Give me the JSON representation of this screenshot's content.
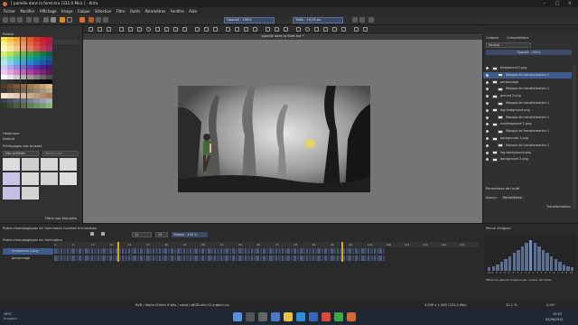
{
  "window": {
    "title": "[ pareille dans la foret.kra (332,0 Mio) ] - Krita"
  },
  "menu": [
    "Fichier",
    "Modifier",
    "Affichage",
    "Image",
    "Calque",
    "Sélection",
    "Filtre",
    "Outils",
    "Paramètres",
    "Fenêtre",
    "Aide"
  ],
  "toolbar": {
    "opacity_label": "Opacité : 100%",
    "size_label": "Taille : 10,00 px"
  },
  "left_panel": {
    "palette_title": "Palette",
    "history_title": "Historique",
    "brushes_title": "Préréglages des brosses",
    "tag_value": "Mes préférés",
    "default_label": "Default",
    "search_placeholder": "Rechercher",
    "filter_label": "Filtrer par étiquette",
    "palette_colors": [
      "#f7e13a",
      "#f4c43a",
      "#f0a334",
      "#e97f2b",
      "#e0572a",
      "#d63228",
      "#c81f2b",
      "#b11d3c",
      "#f8ef8d",
      "#f5d37a",
      "#f0b468",
      "#e99355",
      "#e06b45",
      "#d64439",
      "#c42c3c",
      "#a52551",
      "#fff6c2",
      "#f8e1a1",
      "#f2c68a",
      "#ec9f6e",
      "#e27a5c",
      "#d5534c",
      "#c13a52",
      "#9c2f66",
      "#d9ed63",
      "#b7e05a",
      "#8fce4e",
      "#63ba45",
      "#3fa440",
      "#22913f",
      "#157a40",
      "#0d6342",
      "#a8e8b6",
      "#7fd9a9",
      "#57c89c",
      "#37b595",
      "#1f9f92",
      "#138a8f",
      "#11728c",
      "#125c86",
      "#b1e4f7",
      "#86cff1",
      "#5ab7ea",
      "#3a9ee0",
      "#2886d4",
      "#1f6dc3",
      "#1f56aa",
      "#22408f",
      "#c7c9f4",
      "#a9a8ea",
      "#8d88dd",
      "#7466cd",
      "#6247b8",
      "#5630a0",
      "#4a2386",
      "#3c1c6b",
      "#f2c6ea",
      "#e8a3dc",
      "#d97fcd",
      "#c75dba",
      "#b03fa2",
      "#962c89",
      "#7a2270",
      "#5e1a57",
      "#ffffff",
      "#e6e6e6",
      "#cccccc",
      "#b3b3b3",
      "#999999",
      "#808080",
      "#666666",
      "#4d4d4d",
      "#3b3b3b",
      "#333333",
      "#2b2b2b",
      "#222222",
      "#1a1a1a",
      "#121212",
      "#0a0a0a",
      "#000000",
      "#5a3b23",
      "#6b4a2c",
      "#7d5a35",
      "#8f6b40",
      "#a27d4c",
      "#b58f5a",
      "#c8a26a",
      "#dbb67c",
      "#39352f",
      "#4a443b",
      "#5b5447",
      "#6c6454",
      "#7d7562",
      "#8f8672",
      "#a19882",
      "#b3ab94",
      "#f4e6d2",
      "#ead8c0",
      "#dfc9ae",
      "#d4ba9b",
      "#c9aa89",
      "#be9b77",
      "#b38c66",
      "#a87d56",
      "#3a4050",
      "#4a5060",
      "#5a6070",
      "#6a7080",
      "#7a8090",
      "#8a90a0",
      "#9aa0b0",
      "#aab0c0",
      "#2d3b2a",
      "#3a4c36",
      "#475d42",
      "#546e4e",
      "#617f5a",
      "#6e9066",
      "#7ba172",
      "#88b27e"
    ]
  },
  "canvas": {
    "tab_title": "pareille dans la foret.kra *"
  },
  "right_panel": {
    "tabs": [
      "Calques",
      "Compositions"
    ],
    "blend_mode": "Normal",
    "opacity_value": "Opacité : 100%",
    "layers": [
      {
        "name": "foreground 2.png",
        "indent": 0,
        "selected": false
      },
      {
        "name": "Masque de transformation 1",
        "indent": 1,
        "selected": true
      },
      {
        "name": "personnage",
        "indent": 0,
        "selected": false
      },
      {
        "name": "Masque de transformation 1",
        "indent": 1,
        "selected": false
      },
      {
        "name": "ground 2.png",
        "indent": 0,
        "selected": false
      },
      {
        "name": "Masque de transformation 1",
        "indent": 1,
        "selected": false
      },
      {
        "name": "fog foreground.png",
        "indent": 0,
        "selected": false
      },
      {
        "name": "Masque de transformation 1",
        "indent": 1,
        "selected": false
      },
      {
        "name": "middleground 1.png",
        "indent": 0,
        "selected": false
      },
      {
        "name": "Masque de transformation 1",
        "indent": 1,
        "selected": false
      },
      {
        "name": "background 1.png",
        "indent": 0,
        "selected": false
      },
      {
        "name": "Masque de transformation 1",
        "indent": 1,
        "selected": false
      },
      {
        "name": "fog background.png",
        "indent": 0,
        "selected": false
      },
      {
        "name": "background 2.png",
        "indent": 0,
        "selected": false
      }
    ],
    "tool_options_title": "Paramètres de l'outil",
    "tool_options_tabs": [
      "Aperçu",
      "Paramètres"
    ],
    "tool_options_transform": "Transformation"
  },
  "timeline": {
    "title": "Pelure d'oignon",
    "tabs": [
      "Pistes chronologiques de l'animation",
      "Courbes d'animation"
    ],
    "frame_value": "12",
    "fps_value": "24",
    "speed_value": "Vitesse : 100 %",
    "track_names": [
      "foreground 2.png",
      "personnage"
    ],
    "ruler_marks": [
      "0",
      "6",
      "12",
      "18",
      "24",
      "30",
      "36",
      "42",
      "48",
      "54",
      "60",
      "66",
      "72",
      "78",
      "84",
      "90",
      "96",
      "102",
      "108",
      "114",
      "120",
      "126",
      "132"
    ],
    "onion_footer": "Filtrer les pelures d'oignon par couleur de trame",
    "onion_numbers": [
      "-10",
      "-9",
      "-8",
      "-7",
      "-6",
      "-5",
      "-4",
      "-3",
      "-2",
      "-1",
      "0",
      "1",
      "2",
      "3",
      "4",
      "5",
      "6",
      "7",
      "8",
      "9",
      "10"
    ],
    "onion_levels": [
      0.1,
      0.15,
      0.2,
      0.28,
      0.35,
      0.45,
      0.55,
      0.65,
      0.75,
      0.85,
      0.95,
      0.85,
      0.75,
      0.65,
      0.55,
      0.45,
      0.35,
      0.28,
      0.2,
      0.15,
      0.1
    ]
  },
  "status": {
    "center": "RVB / Alpha (Entier 8 bits / canal) sRGB-elle-V2-srgbtrc.icc",
    "right_size": "3 839 x 1 080 (332,0 Mio)",
    "zoom": "32,1 %",
    "rotation": "0,00°"
  },
  "taskbar": {
    "weather_temp": "19°C",
    "weather_text": "Nuageux",
    "time": "19:52",
    "date": "02/06/2022"
  }
}
